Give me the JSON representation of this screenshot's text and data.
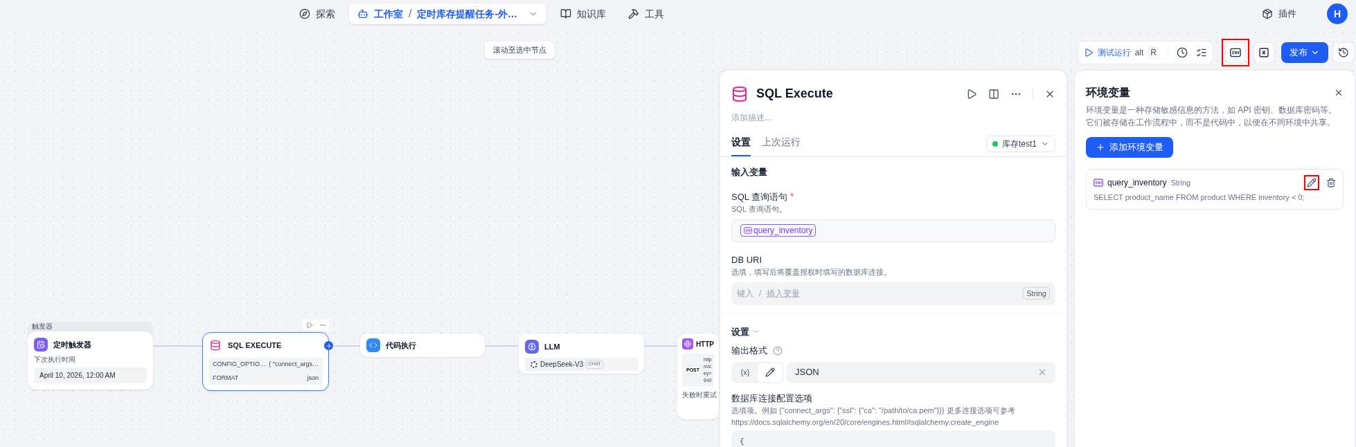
{
  "nav": {
    "items": [
      {
        "kind": "link",
        "label": "探索",
        "selected": false
      },
      {
        "kind": "studio",
        "label": "工作室",
        "separator": "/",
        "breadcrumb": "定时库存提醒任务-外…",
        "selected": true
      },
      {
        "kind": "link",
        "label": "知识库",
        "selected": false
      },
      {
        "kind": "tool",
        "label": "工具",
        "selected": false
      }
    ],
    "plugins": "插件",
    "avatar": "H"
  },
  "scroll_hint": "滚动至选中节点",
  "toolbar": {
    "test_run": "测试运行",
    "shortcut_alt": "alt",
    "shortcut_key": "R",
    "env_highlighted": true,
    "publish": "发布"
  },
  "nodes": [
    {
      "kind": "trigger",
      "group_label": "触发器",
      "title": "定时触发器",
      "field_label": "下次执行时间",
      "value": "April 10, 2026, 12:00 AM",
      "selected": false
    },
    {
      "kind": "sql",
      "title": "SQL EXECUTE",
      "selected": true,
      "rows": [
        {
          "key": "CONFIG_OPTIO…",
          "value": "{ \"connect_args…"
        },
        {
          "key": "FORMAT",
          "value": "json"
        }
      ]
    },
    {
      "kind": "code",
      "title": "代码执行",
      "selected": false
    },
    {
      "kind": "llm",
      "title": "LLM",
      "model": "DeepSeek-V3",
      "tag": "CHAT",
      "selected": false
    },
    {
      "kind": "http",
      "title": "HTTP",
      "method": "POST",
      "url_lines": [
        "http",
        "m/c",
        "ey=",
        "640"
      ],
      "footer": "失败时重试",
      "selected": false
    }
  ],
  "panel": {
    "title": "SQL Execute",
    "description_placeholder": "添加描述...",
    "tabs": [
      {
        "label": "设置",
        "selected": true
      },
      {
        "label": "上次运行",
        "selected": false
      }
    ],
    "environment": "库存test1",
    "input_section": "输入变量",
    "fields": [
      {
        "kind": "variable",
        "label": "SQL 查询语句",
        "required_mark": "*",
        "hint": "SQL 查询语句。",
        "value": "query_inventory"
      },
      {
        "kind": "text",
        "label": "DB URI",
        "hint": "选填，填写后将覆盖授权时填写的数据库连接。",
        "placeholder_type": "键入",
        "placeholder_slash": "/",
        "placeholder_insert": "插入变量",
        "type": "String"
      }
    ],
    "settings": {
      "title": "设置",
      "expanded": true,
      "output_label": "输出格式",
      "mode_variable": "{x}",
      "mode_manual_selected": true,
      "output_value": "JSON",
      "options_label": "数据库连接配置选项",
      "options_hint": "选填项。例如 {\"connect_args\": {\"ssl\": {\"ca\": \"/path/to/ca.pem\"}}} 更多连接选项可参考 https://docs.sqlalchemy.org/en/20/core/engines.html#sqlalchemy.create_engine",
      "code_first_line": "{"
    }
  },
  "env_panel": {
    "title": "环境变量",
    "description": "环境变量是一种存储敏感信息的方法，如 API 密钥、数据库密码等。它们被存储在工作流程中，而不是代码中，以便在不同环境中共享。",
    "add_button": "添加环境变量",
    "variables": [
      {
        "name": "query_inventory",
        "type": "String",
        "value": "SELECT product_name FROM product WHERE inventory < 0;",
        "edit_highlighted": true
      }
    ]
  }
}
